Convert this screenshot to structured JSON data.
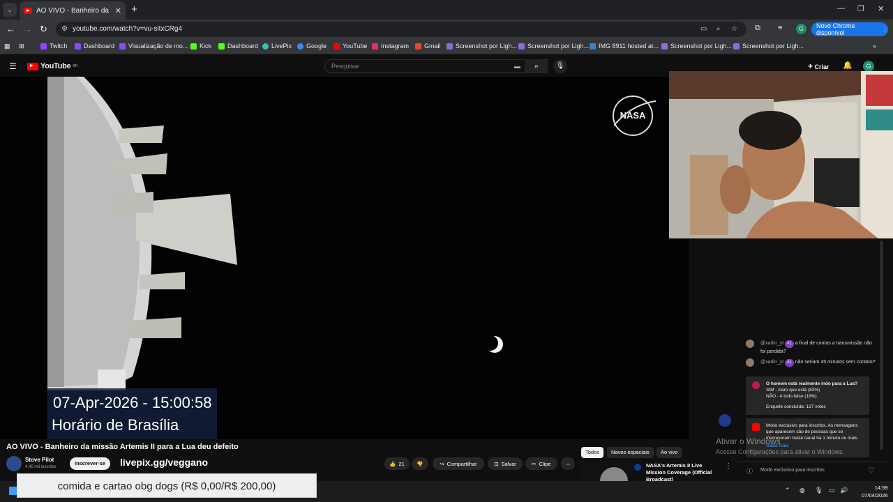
{
  "browser": {
    "tab_title": "AO VIVO - Banheiro da missão",
    "url": "youtube.com/watch?v=vu-sitxCRg4",
    "update_button": "Novo Chrome disponível",
    "profile_letter": "G",
    "bookmarks": [
      {
        "label": "Twitch",
        "color": "#9146ff"
      },
      {
        "label": "Dashboard",
        "color": "#9146ff"
      },
      {
        "label": "Visualização de mo...",
        "color": "#9146ff"
      },
      {
        "label": "Kick",
        "color": "#53fc18"
      },
      {
        "label": "Dashboard",
        "color": "#53fc18"
      },
      {
        "label": "LivePix",
        "color": "#2ec4b6"
      },
      {
        "label": "Google",
        "color": "#4285f4"
      },
      {
        "label": "YouTube",
        "color": "#ff0000"
      },
      {
        "label": "Instagram",
        "color": "#e1306c"
      },
      {
        "label": "Gmail",
        "color": "#ea4335"
      },
      {
        "label": "Screenshot por Ligh...",
        "color": "#8e6bd8"
      },
      {
        "label": "Screenshot por Ligh...",
        "color": "#8e6bd8"
      },
      {
        "label": "IMG 8911 hosted at...",
        "color": "#3b82c4"
      },
      {
        "label": "Screenshot por Ligh...",
        "color": "#8e6bd8"
      },
      {
        "label": "Screenshot por Ligh...",
        "color": "#8e6bd8"
      }
    ]
  },
  "youtube": {
    "logo_text": "YouTube",
    "logo_country": "BR",
    "search_placeholder": "Pesquisar",
    "create_label": "Criar",
    "avatar_letter": "G"
  },
  "video": {
    "overlay_date": "07-Apr-2026 - 15:00:58",
    "overlay_timezone": "Horário de Brasília",
    "nasa_logo": "NASA",
    "title": "AO VIVO - Banheiro da missão Artemis II para a Lua deu defeito",
    "channel_name": "Stove Pilot",
    "channel_subs": "4,45 mil inscritos",
    "subscribe_label": "Inscrever-se",
    "livepix_text": "livepix.gg/veggano",
    "likes": "21",
    "share_label": "Compartilhar",
    "save_label": "Salvar",
    "clip_label": "Clipe",
    "donation_goal": "comida e cartao obg dogs (R$ 0,00/R$ 200,00)"
  },
  "chat": {
    "messages": [
      {
        "user": "@xarlin_yt",
        "badge": "#1",
        "text": "a final de contas a transmissão não foi perdida?"
      },
      {
        "user": "@xarlin_yt",
        "badge": "#1",
        "text": "não seriam 45 minutos sem contato?"
      }
    ],
    "poll": {
      "question": "O homem está realmente indo para a Lua?",
      "option1": "SIM - claro que está (82%)",
      "option2": "NÃO - é tudo falso (18%)",
      "result": "Enquete concluída: 137 votos"
    },
    "notice": "Modo exclusivo para inscritos. As mensagens que aparecem são de pessoas que se inscreveram neste canal há 1 minuto ou mais.",
    "notice_link": "Saiba mais",
    "footer": "Modo exclusivo para inscritos"
  },
  "sidebar": {
    "chips": [
      "Todos",
      "Naves espaciais",
      "Ao vivo"
    ],
    "rec_title": "NASA's Artemis II Live Mission Coverage (Official Broadcast)"
  },
  "os": {
    "activate_title": "Ativar o Windows",
    "activate_sub": "Acesse Configurações para ativar o Windows.",
    "time": "14:59",
    "date": "07/04/2026"
  }
}
